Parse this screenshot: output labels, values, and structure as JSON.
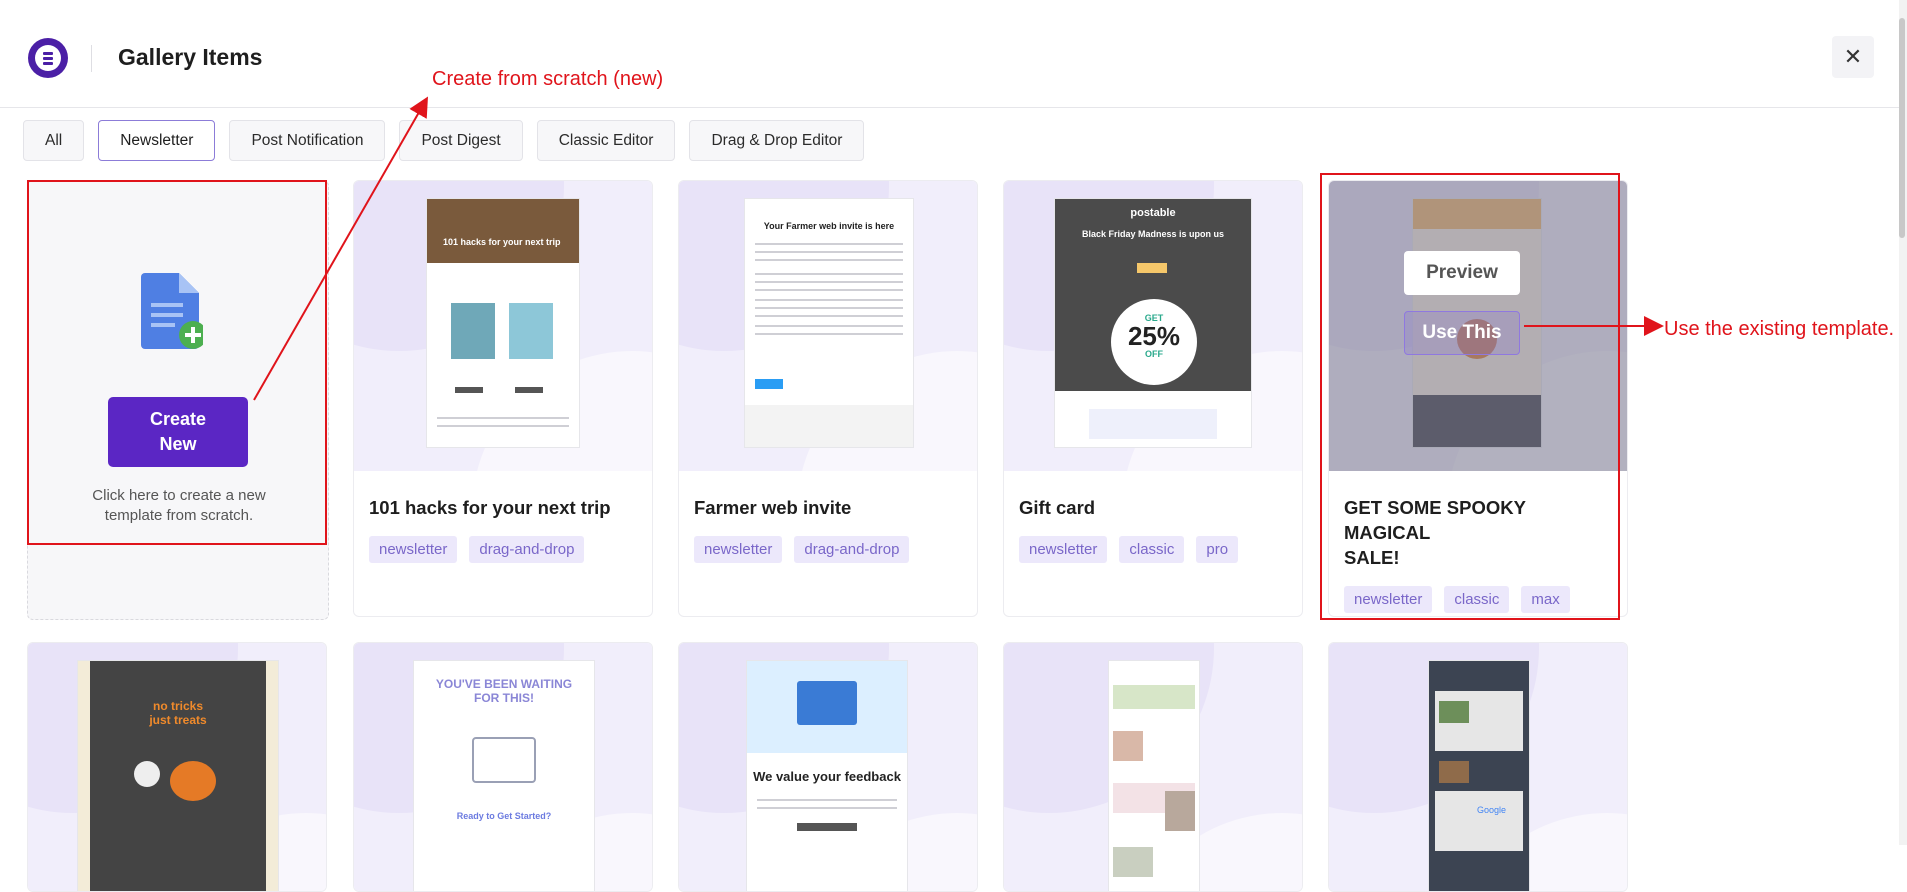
{
  "header": {
    "title": "Gallery Items",
    "close_glyph": "✕"
  },
  "tabs": [
    {
      "label": "All",
      "active": false
    },
    {
      "label": "Newsletter",
      "active": true
    },
    {
      "label": "Post Notification",
      "active": false
    },
    {
      "label": "Post Digest",
      "active": false
    },
    {
      "label": "Classic Editor",
      "active": false
    },
    {
      "label": "Drag & Drop Editor",
      "active": false
    }
  ],
  "create_card": {
    "button_label_line1": "Create",
    "button_label_line2": "New",
    "hint_line1": "Click here to create a new",
    "hint_line2": "template from scratch."
  },
  "templates": [
    {
      "name": "101 hacks for your next trip",
      "tags": [
        "newsletter",
        "drag-and-drop"
      ],
      "thumb_title": "101 hacks for your next trip"
    },
    {
      "name": "Farmer web invite",
      "tags": [
        "newsletter",
        "drag-and-drop"
      ],
      "thumb_title": "Your Farmer web invite is here"
    },
    {
      "name": "Gift card",
      "tags": [
        "newsletter",
        "classic",
        "pro"
      ],
      "thumb_brand": "postable",
      "thumb_title": "Black Friday Madness is upon us",
      "thumb_badge_top": "GET",
      "thumb_badge_value": "25%",
      "thumb_badge_bottom": "OFF"
    },
    {
      "name": "GET SOME SPOOKY MAGICAL SALE!",
      "name_line1": "GET SOME SPOOKY MAGICAL",
      "name_line2": "SALE!",
      "tags": [
        "newsletter",
        "classic",
        "max"
      ],
      "overlay": {
        "preview_label": "Preview",
        "use_label": "Use This"
      }
    }
  ],
  "row2_thumbs": [
    {
      "line1": "no tricks",
      "line2": "just treats"
    },
    {
      "line1": "YOU'VE BEEN WAITING",
      "line2": "FOR THIS!",
      "line3": "Ready to Get Started?"
    },
    {
      "line1": "We value your feedback"
    },
    {
      "line1": ""
    },
    {
      "line1": "Google"
    }
  ],
  "annotations": {
    "create_note": "Create from scratch (new)",
    "use_note": "Use the existing template."
  },
  "colors": {
    "accent": "#5b26c4",
    "annotation_red": "#e0141b",
    "tag_bg": "#ece8fb"
  }
}
